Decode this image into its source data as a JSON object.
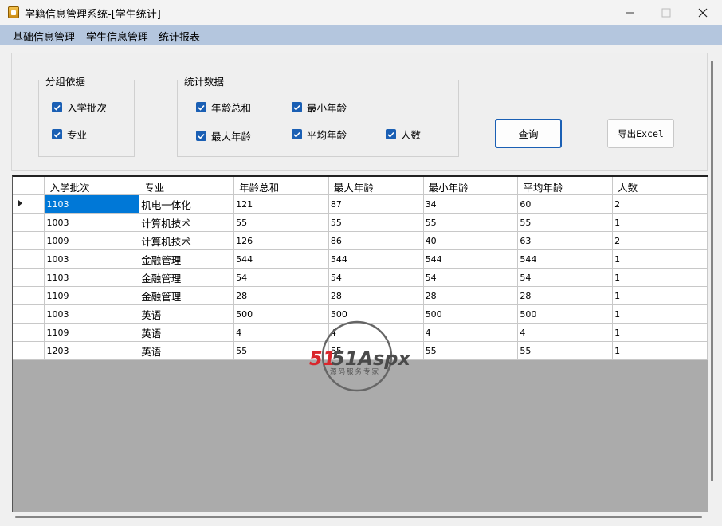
{
  "window": {
    "title": "学籍信息管理系统-[学生统计]",
    "controls": [
      "minimize",
      "maximize",
      "close"
    ]
  },
  "menu": {
    "items": [
      "基础信息管理",
      "学生信息管理",
      "统计报表"
    ]
  },
  "group_by": {
    "legend": "分组依据",
    "options": [
      {
        "label": "入学批次",
        "checked": true
      },
      {
        "label": "专业",
        "checked": true
      }
    ]
  },
  "stats": {
    "legend": "统计数据",
    "options": [
      {
        "label": "年龄总和",
        "checked": true
      },
      {
        "label": "最小年龄",
        "checked": true
      },
      {
        "label": "最大年龄",
        "checked": true
      },
      {
        "label": "平均年龄",
        "checked": true
      },
      {
        "label": "人数",
        "checked": true
      }
    ]
  },
  "buttons": {
    "query": "查询",
    "export": "导出Excel"
  },
  "grid": {
    "columns": [
      "入学批次",
      "专业",
      "年龄总和",
      "最大年龄",
      "最小年龄",
      "平均年龄",
      "人数"
    ],
    "rows": [
      [
        "1103",
        "机电一体化",
        "121",
        "87",
        "34",
        "60",
        "2"
      ],
      [
        "1003",
        "计算机技术",
        "55",
        "55",
        "55",
        "55",
        "1"
      ],
      [
        "1009",
        "计算机技术",
        "126",
        "86",
        "40",
        "63",
        "2"
      ],
      [
        "1003",
        "金融管理",
        "544",
        "544",
        "544",
        "544",
        "1"
      ],
      [
        "1103",
        "金融管理",
        "54",
        "54",
        "54",
        "54",
        "1"
      ],
      [
        "1109",
        "金融管理",
        "28",
        "28",
        "28",
        "28",
        "1"
      ],
      [
        "1003",
        "英语",
        "500",
        "500",
        "500",
        "500",
        "1"
      ],
      [
        "1109",
        "英语",
        "4",
        "4",
        "4",
        "4",
        "1"
      ],
      [
        "1203",
        "英语",
        "55",
        "55",
        "55",
        "55",
        "1"
      ]
    ],
    "current_row": 0,
    "selected_cell": [
      0,
      0
    ]
  },
  "watermark": {
    "brand": "51Aspx",
    "tagline": "源码服务专家"
  },
  "colors": {
    "menubar": "#b4c6de",
    "checkbox": "#1a5fb4",
    "selection": "#0078d7",
    "grid_empty": "#ababab",
    "watermark_red": "#d9262c",
    "watermark_green": "#4a9a32"
  }
}
